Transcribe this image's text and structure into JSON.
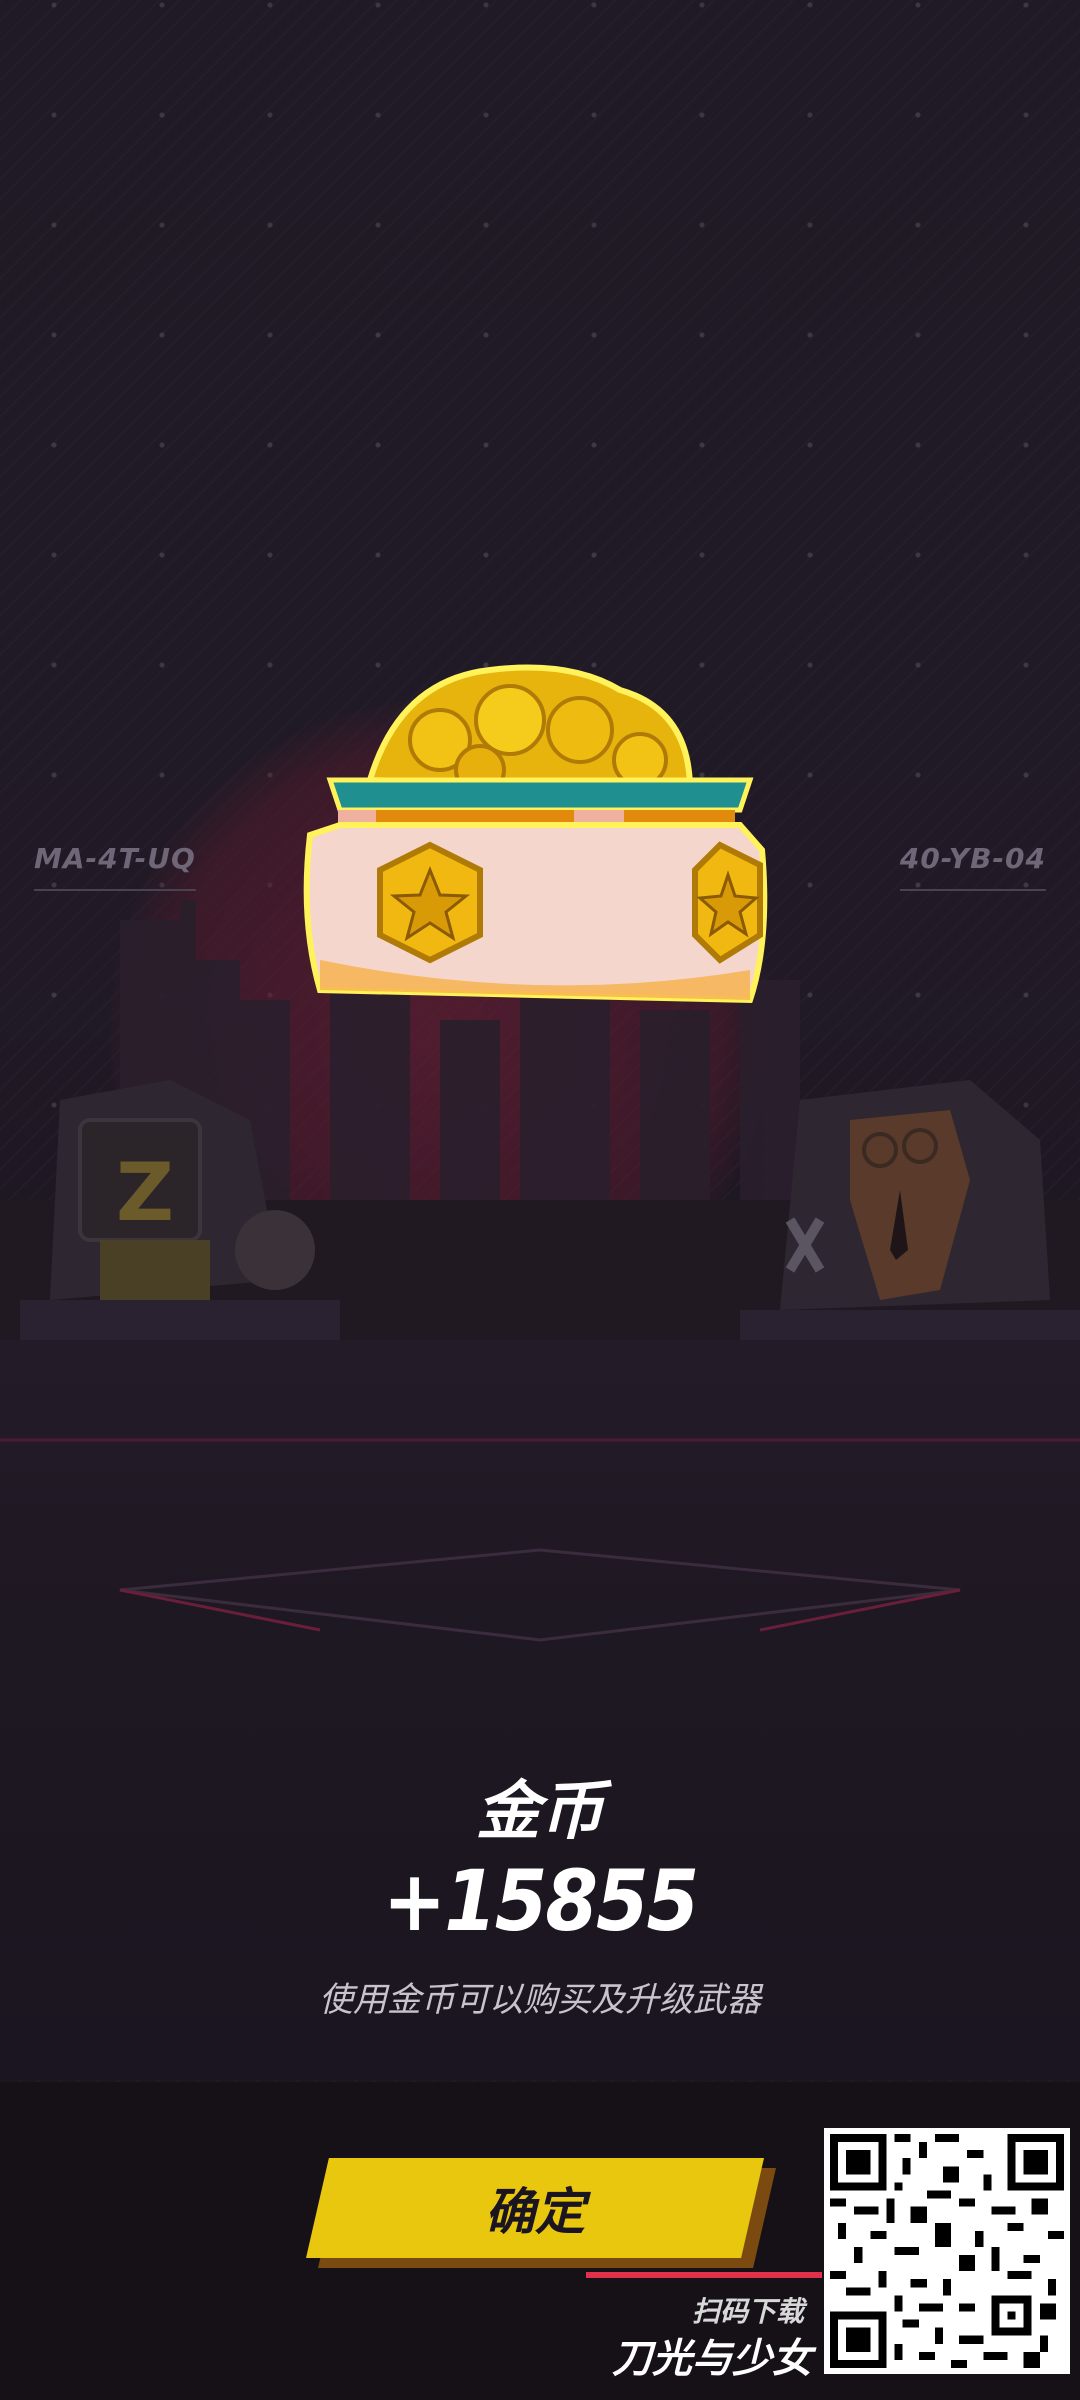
{
  "scene": {
    "left_code": "MA-4T-UQ",
    "right_code": "40-YB-04",
    "left_character_letter": "Z"
  },
  "reward": {
    "item_name": "金币",
    "amount": "+15855",
    "description": "使用金币可以购买及升级武器",
    "icon": "gold-coin-chest-icon"
  },
  "actions": {
    "confirm_label": "确定"
  },
  "branding": {
    "download_text": "扫码下载",
    "game_name": "刀光与少女",
    "qr_icon": "qr-code-icon"
  },
  "colors": {
    "accent_yellow": "#e8c70e",
    "accent_red": "#e0304a",
    "background": "#1f1a25"
  }
}
